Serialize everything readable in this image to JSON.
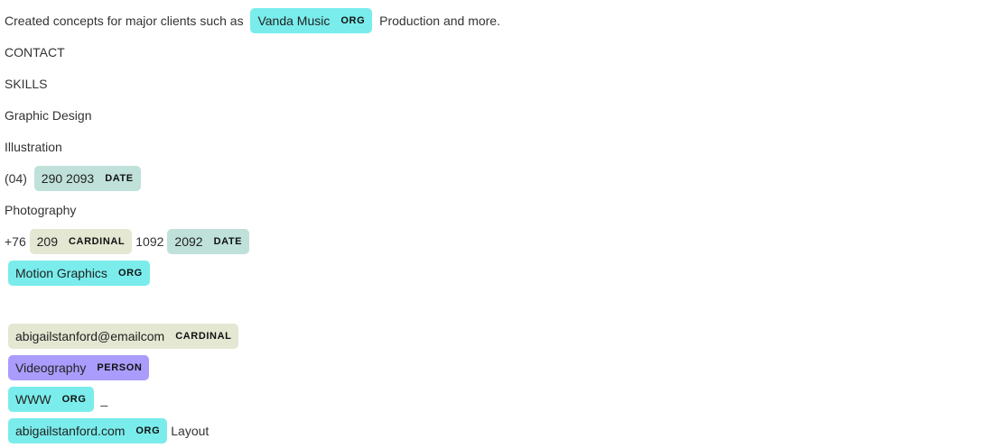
{
  "lines": [
    {
      "pre": "Created concepts for major clients such as ",
      "ent": {
        "text": "Vanda Music",
        "label": "ORG"
      },
      "post": " Production and more."
    },
    {
      "text": "CONTACT"
    },
    {
      "text": "SKILLS"
    },
    {
      "text": "Graphic Design"
    },
    {
      "text": "Illustration"
    },
    {
      "pre": "(04) ",
      "ent": {
        "text": "290 2093",
        "label": "DATE"
      }
    },
    {
      "text": "Photography"
    },
    {
      "pre": "+76 ",
      "ent": {
        "text": "209",
        "label": "CARDINAL"
      },
      "mid": "1092",
      "ent2": {
        "text": "2092",
        "label": "DATE"
      }
    },
    {
      "ent": {
        "text": "Motion Graphics",
        "label": "ORG"
      }
    },
    {
      "ent": {
        "text": "abigailstanford@emailcom",
        "label": "CARDINAL"
      }
    },
    {
      "ent": {
        "text": "Videography",
        "label": "PERSON"
      }
    },
    {
      "ent": {
        "text": "WWW",
        "label": "ORG"
      },
      "post": " _"
    },
    {
      "ent": {
        "text": "abigailstanford.com",
        "label": "ORG"
      },
      "post": "Layout"
    }
  ],
  "colors": {
    "ORG": "#7aecec",
    "DATE": "#bfe1d9",
    "CARDINAL": "#e4e7d2",
    "PERSON": "#aa9cfc"
  }
}
